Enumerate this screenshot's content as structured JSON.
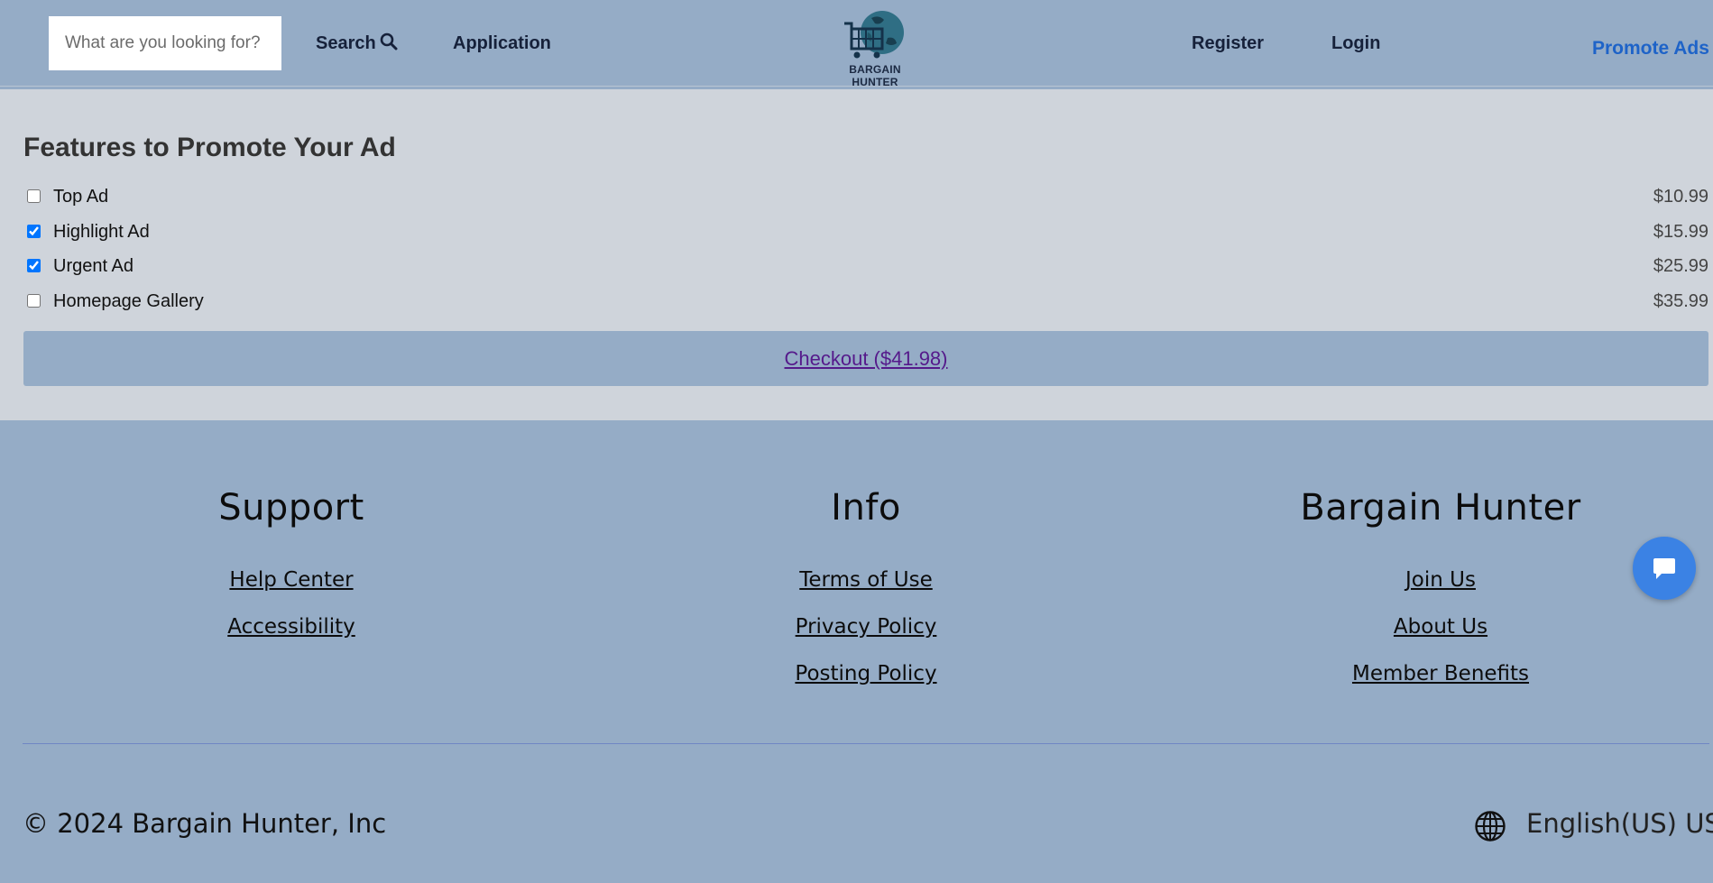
{
  "header": {
    "search_placeholder": "What are you looking for?",
    "search_label": "Search",
    "application_label": "Application",
    "logo_text": "BARGAIN HUNTER",
    "register_label": "Register",
    "login_label": "Login",
    "promote_label": "Promote Ads"
  },
  "promo": {
    "title": "Features to Promote Your Ad",
    "features": [
      {
        "label": "Top Ad",
        "price": "$10.99",
        "checked": false
      },
      {
        "label": "Highlight Ad",
        "price": "$15.99",
        "checked": true
      },
      {
        "label": "Urgent Ad",
        "price": "$25.99",
        "checked": true
      },
      {
        "label": "Homepage Gallery",
        "price": "$35.99",
        "checked": false
      }
    ],
    "checkout_label": "Checkout ($41.98)"
  },
  "footer": {
    "support": {
      "heading": "Support",
      "links": [
        "Help Center",
        "Accessibility"
      ]
    },
    "info": {
      "heading": "Info",
      "links": [
        "Terms of Use",
        "Privacy Policy",
        "Posting Policy"
      ]
    },
    "brand": {
      "heading": "Bargain Hunter",
      "links": [
        "Join Us",
        "About Us",
        "Member Benefits"
      ]
    },
    "copyright": "© 2024 Bargain Hunter, Inc",
    "language": "English(US) US $"
  },
  "colors": {
    "background": "#95acc6",
    "promo_panel": "#cfd4db",
    "accent_link": "#1e63c8",
    "chat_button": "#3b82e4"
  },
  "icons": [
    "search-icon",
    "logo-globe-cart-icon",
    "globe-icon",
    "chat-icon"
  ]
}
